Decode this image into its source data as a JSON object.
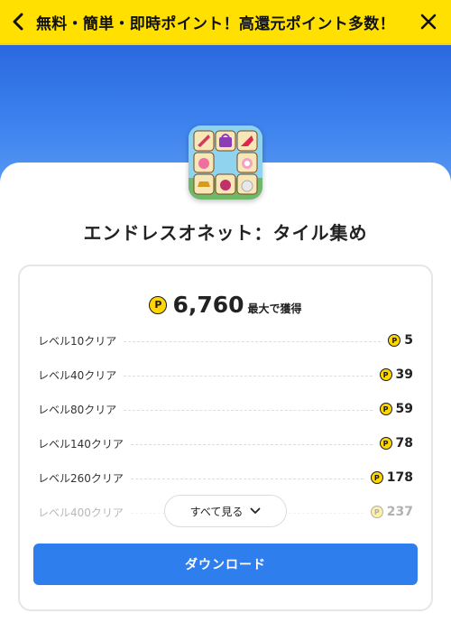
{
  "header": {
    "title": "無料・簡単・即時ポイント！高還元ポイント多数！"
  },
  "app": {
    "name": "エンドレスオネット：タイル集め",
    "icon": "tile-matching-game-icon"
  },
  "points": {
    "coin_symbol": "P",
    "total": "6,760",
    "total_suffix": "最大で獲得"
  },
  "rewards": [
    {
      "label": "レベル10クリア",
      "value": "5"
    },
    {
      "label": "レベル40クリア",
      "value": "39"
    },
    {
      "label": "レベル80クリア",
      "value": "59"
    },
    {
      "label": "レベル140クリア",
      "value": "78"
    },
    {
      "label": "レベル260クリア",
      "value": "178"
    },
    {
      "label": "レベル400クリア",
      "value": "237"
    }
  ],
  "see_all_label": "すべて見る",
  "download_label": "ダウンロード",
  "colors": {
    "header_bg": "#ffe000",
    "hero_blue": "#2a68df",
    "button_blue": "#2e7fed",
    "coin": "#ffd600"
  }
}
